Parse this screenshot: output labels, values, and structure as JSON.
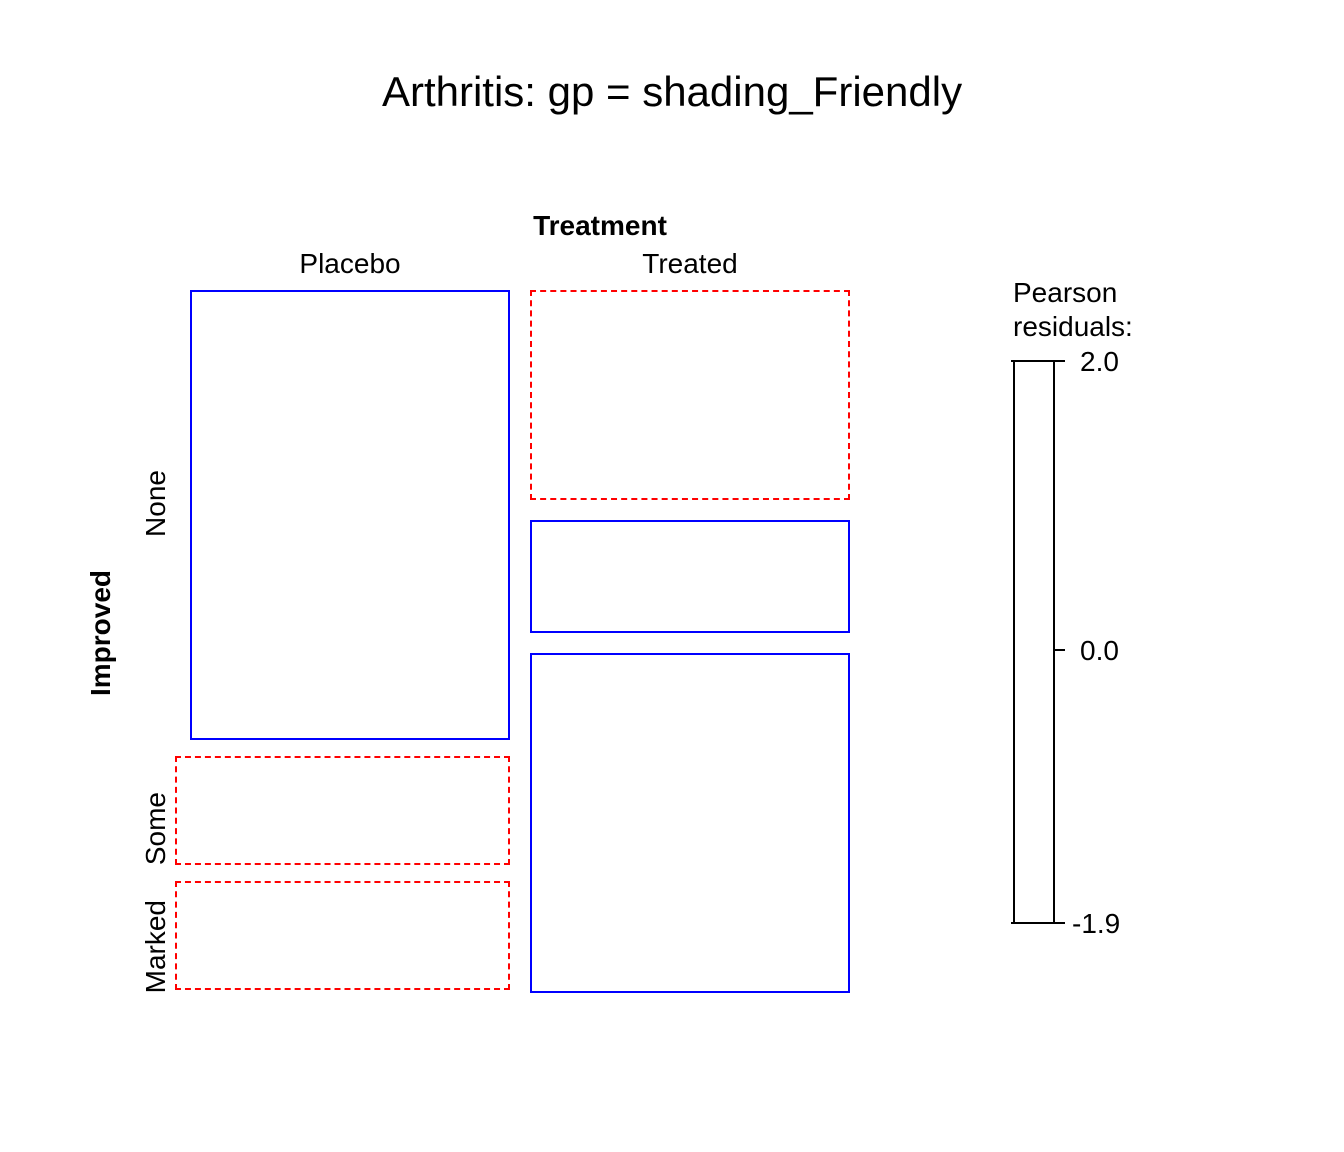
{
  "title": "Arthritis: gp = shading_Friendly",
  "axis": {
    "top_title": "Treatment",
    "left_title": "Improved",
    "cols": [
      "Placebo",
      "Treated"
    ],
    "rows": [
      "None",
      "Some",
      "Marked"
    ]
  },
  "legend": {
    "title_l1": "Pearson",
    "title_l2": "residuals:",
    "top_value": "2.0",
    "mid_value": "0.0",
    "bottom_value": "-1.9"
  },
  "chart_data": {
    "type": "mosaic",
    "title": "Arthritis: gp = shading_Friendly",
    "row_var": "Improved",
    "col_var": "Treatment",
    "col_labels": [
      "Placebo",
      "Treated"
    ],
    "row_labels": [
      "None",
      "Some",
      "Marked"
    ],
    "residual_range": [
      -1.9,
      2.0
    ],
    "residual_scale_ticks": [
      2.0,
      0.0,
      -1.9
    ],
    "cells": [
      {
        "row": "None",
        "col": "Placebo",
        "residual_sign": "positive",
        "style": "solid-blue",
        "row_prop": 0.674,
        "col_prop": 0.488
      },
      {
        "row": "Some",
        "col": "Placebo",
        "residual_sign": "negative",
        "style": "dashed-red",
        "row_prop": 0.163,
        "col_prop": 0.488
      },
      {
        "row": "Marked",
        "col": "Placebo",
        "residual_sign": "negative",
        "style": "dashed-red",
        "row_prop": 0.163,
        "col_prop": 0.488
      },
      {
        "row": "None",
        "col": "Treated",
        "residual_sign": "negative",
        "style": "dashed-red",
        "row_prop": 0.317,
        "col_prop": 0.488
      },
      {
        "row": "Some",
        "col": "Treated",
        "residual_sign": "positive",
        "style": "solid-blue",
        "row_prop": 0.171,
        "col_prop": 0.488
      },
      {
        "row": "Marked",
        "col": "Treated",
        "residual_sign": "positive",
        "style": "solid-blue",
        "row_prop": 0.512,
        "col_prop": 0.488
      }
    ],
    "legend": {
      "title": "Pearson residuals:",
      "ticks": [
        "2.0",
        "0.0",
        "-1.9"
      ]
    }
  }
}
